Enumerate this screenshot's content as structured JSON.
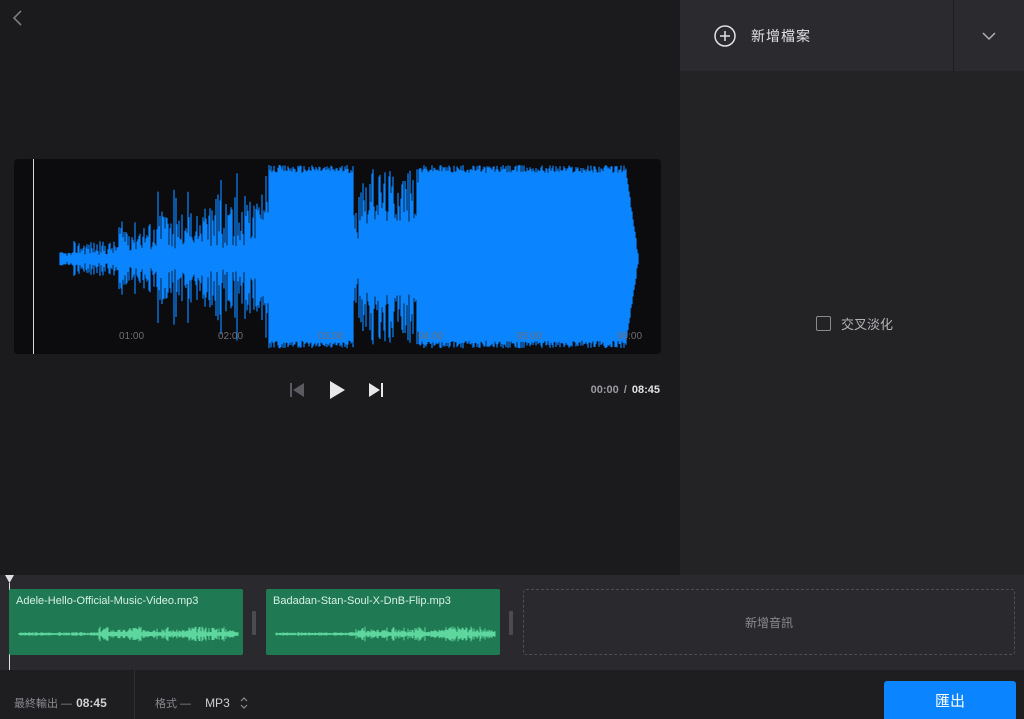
{
  "header": {
    "back_icon": "chevron-left-icon"
  },
  "sidebar": {
    "add_file_label": "新增檔案",
    "add_icon": "plus-circle-icon",
    "dropdown_icon": "chevron-down-icon",
    "crossfade_label": "交叉淡化",
    "crossfade_checked": false
  },
  "player": {
    "ticks": [
      "01:00",
      "02:00",
      "03:00",
      "04:00",
      "05:00",
      "06:00"
    ],
    "current_time": "00:00",
    "separator": "/",
    "total_time": "08:45",
    "waveform_color": "#0b84ff"
  },
  "timeline": {
    "clips": [
      {
        "name": "Adele-Hello-Official-Music-Video.mp3"
      },
      {
        "name": "Badadan-Stan-Soul-X-DnB-Flip.mp3"
      }
    ],
    "add_audio_label": "新增音訊",
    "clip_color": "#1f7a53"
  },
  "footer": {
    "output_label": "最終輸出 —",
    "output_value": "08:45",
    "format_label": "格式 —",
    "format_value": "MP3",
    "export_label": "匯出",
    "export_color": "#0b84ff"
  }
}
